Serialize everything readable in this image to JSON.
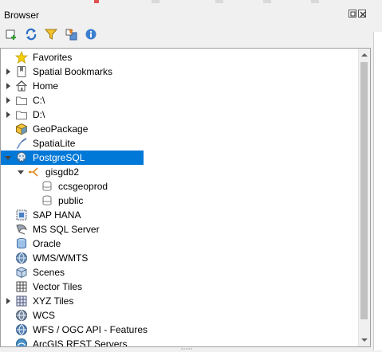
{
  "panel": {
    "title": "Browser",
    "float_icon": "float-panel-icon",
    "close_icon": "close-panel-icon"
  },
  "toolbar": [
    {
      "icon": "add-selected-layers-icon"
    },
    {
      "icon": "refresh-icon"
    },
    {
      "icon": "filter-icon"
    },
    {
      "icon": "collapse-all-icon"
    },
    {
      "icon": "info-icon"
    }
  ],
  "tree": {
    "items": [
      {
        "label": "Favorites",
        "icon": "star-icon",
        "expander": "none",
        "level": 0
      },
      {
        "label": "Spatial Bookmarks",
        "icon": "bookmark-icon",
        "expander": "collapsed",
        "level": 0
      },
      {
        "label": "Home",
        "icon": "home-icon",
        "expander": "collapsed",
        "level": 0
      },
      {
        "label": "C:\\",
        "icon": "folder-icon",
        "expander": "collapsed",
        "level": 0
      },
      {
        "label": "D:\\",
        "icon": "folder-icon",
        "expander": "collapsed",
        "level": 0
      },
      {
        "label": "GeoPackage",
        "icon": "geopackage-icon",
        "expander": "none",
        "level": 0
      },
      {
        "label": "SpatiaLite",
        "icon": "spatialite-icon",
        "expander": "none",
        "level": 0
      },
      {
        "label": "PostgreSQL",
        "icon": "postgresql-icon",
        "expander": "expanded",
        "level": 0,
        "selected": true
      },
      {
        "label": "gisgdb2",
        "icon": "connection-icon",
        "expander": "expanded",
        "level": 1
      },
      {
        "label": "ccsgeoprod",
        "icon": "schema-icon",
        "expander": "none",
        "level": 2
      },
      {
        "label": "public",
        "icon": "schema-icon",
        "expander": "none",
        "level": 2
      },
      {
        "label": "SAP HANA",
        "icon": "sap-hana-icon",
        "expander": "none",
        "level": 0
      },
      {
        "label": "MS SQL Server",
        "icon": "mssql-icon",
        "expander": "none",
        "level": 0
      },
      {
        "label": "Oracle",
        "icon": "oracle-icon",
        "expander": "none",
        "level": 0
      },
      {
        "label": "WMS/WMTS",
        "icon": "wms-icon",
        "expander": "none",
        "level": 0
      },
      {
        "label": "Scenes",
        "icon": "scenes-icon",
        "expander": "none",
        "level": 0
      },
      {
        "label": "Vector Tiles",
        "icon": "vector-tiles-icon",
        "expander": "none",
        "level": 0
      },
      {
        "label": "XYZ Tiles",
        "icon": "xyz-tiles-icon",
        "expander": "collapsed",
        "level": 0
      },
      {
        "label": "WCS",
        "icon": "wcs-icon",
        "expander": "none",
        "level": 0
      },
      {
        "label": "WFS / OGC API - Features",
        "icon": "wfs-icon",
        "expander": "none",
        "level": 0
      },
      {
        "label": "ArcGIS REST Servers",
        "icon": "arcgis-icon",
        "expander": "none",
        "level": 0
      }
    ]
  },
  "colors": {
    "selection": "#0078d7",
    "panel_bg": "#f0f0f0",
    "tree_bg": "#ffffff"
  }
}
